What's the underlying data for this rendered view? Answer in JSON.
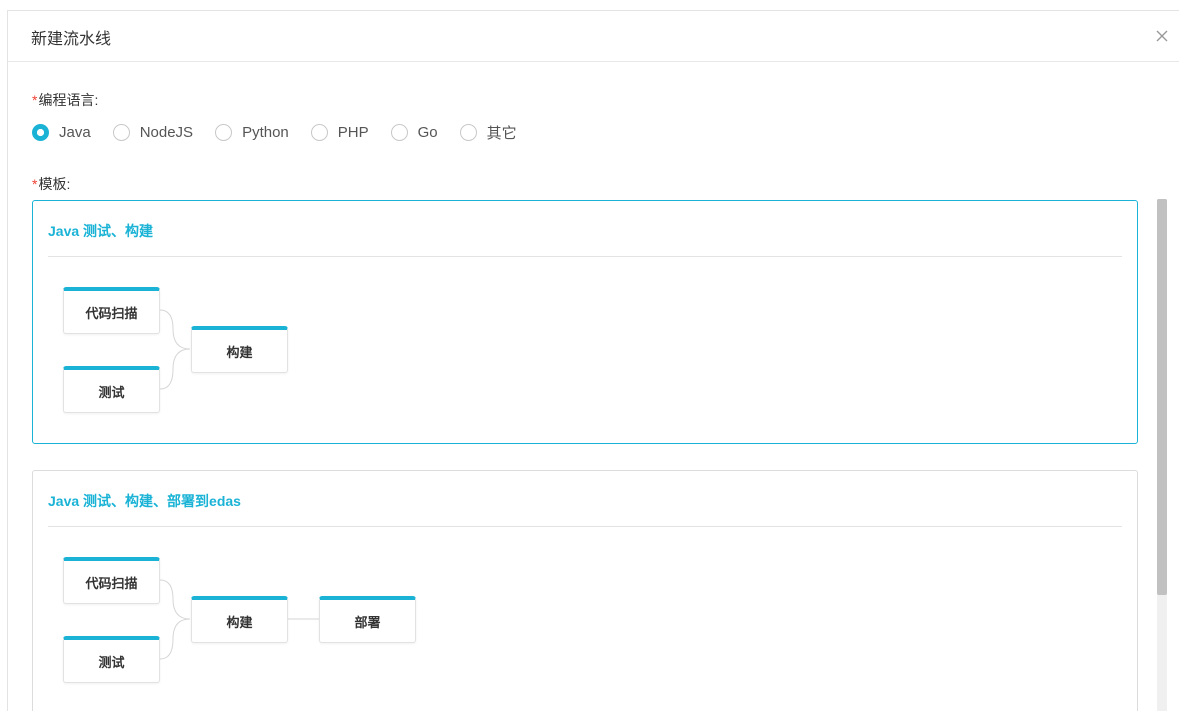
{
  "dialog": {
    "title": "新建流水线",
    "close_icon": "close-icon"
  },
  "language": {
    "label": "编程语言:",
    "required_mark": "*",
    "options": [
      "Java",
      "NodeJS",
      "Python",
      "PHP",
      "Go",
      "其它"
    ],
    "selected": "Java"
  },
  "template": {
    "label": "模板:",
    "required_mark": "*"
  },
  "cards": [
    {
      "title": "Java 测试、构建",
      "selected": true,
      "stages": {
        "scan": "代码扫描",
        "test": "测试",
        "build": "构建"
      }
    },
    {
      "title": "Java 测试、构建、部署到edas",
      "selected": false,
      "stages": {
        "scan": "代码扫描",
        "test": "测试",
        "build": "构建",
        "deploy": "部署"
      }
    }
  ],
  "colors": {
    "accent": "#1ab3d6",
    "required": "#f04134"
  }
}
